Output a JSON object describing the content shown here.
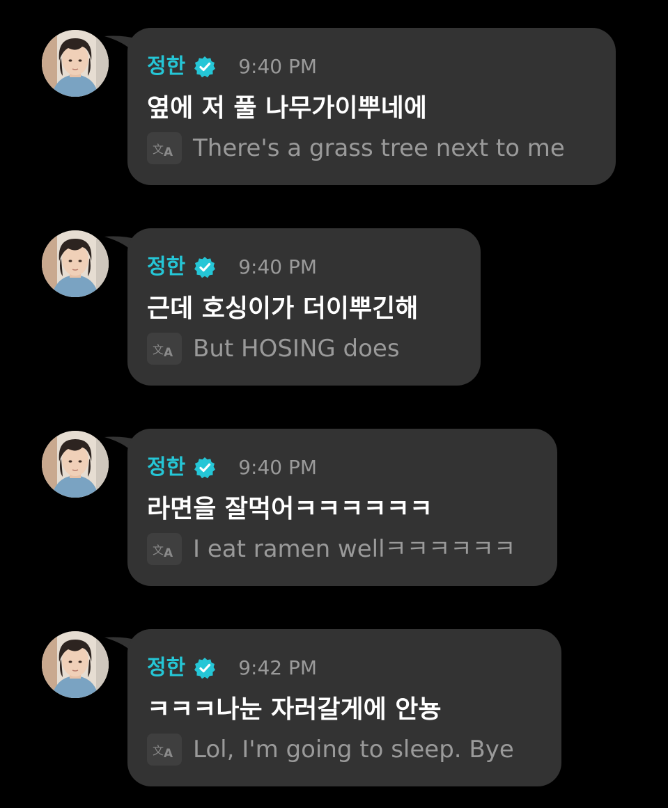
{
  "colors": {
    "background": "#000000",
    "bubble": "#333333",
    "sender_name": "#25c6d6",
    "verified_badge": "#25c6d6",
    "message_text": "#ffffff",
    "secondary_text": "#9a9a9a"
  },
  "icons": {
    "avatar": "profile-photo",
    "verified": "verified-check-badge",
    "translate": "translate-icon"
  },
  "messages": [
    {
      "sender": "정한",
      "time": "9:40 PM",
      "text": "옆에 저 풀 나무가이뿌네에",
      "translation": "There's a grass tree next to me"
    },
    {
      "sender": "정한",
      "time": "9:40 PM",
      "text": "근데 호싱이가 더이뿌긴해",
      "translation": "But HOSING does"
    },
    {
      "sender": "정한",
      "time": "9:40 PM",
      "text": "라면을 잘먹어ㅋㅋㅋㅋㅋㅋ",
      "translation": "I eat ramen wellㅋㅋㅋㅋㅋㅋ"
    },
    {
      "sender": "정한",
      "time": "9:42 PM",
      "text": "ㅋㅋㅋ나눈 자러갈게에 안뇽",
      "translation": "Lol, I'm going to sleep. Bye"
    }
  ]
}
